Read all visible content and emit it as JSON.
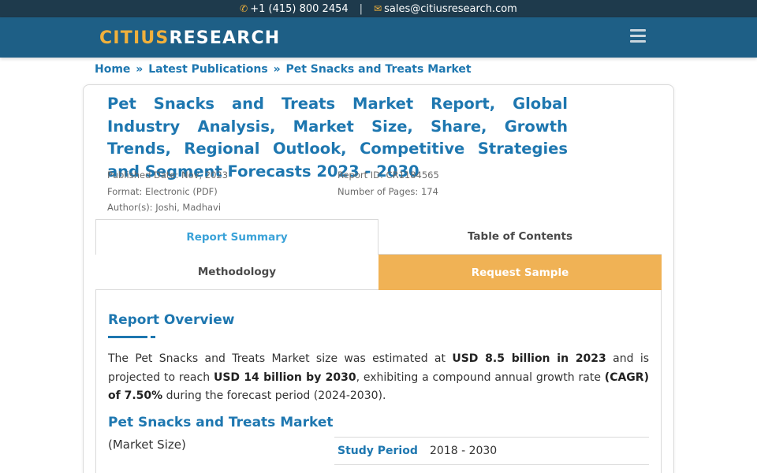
{
  "topbar": {
    "phone": "+1 (415) 800 2454",
    "separator": "|",
    "email": "sales@citiusresearch.com"
  },
  "brand": {
    "logo_part1": "CITIUS",
    "logo_part2": "RESEARCH"
  },
  "breadcrumb": {
    "home": "Home",
    "sep": "»",
    "latest": "Latest Publications",
    "current": "Pet Snacks and Treats Market"
  },
  "report": {
    "title": "Pet Snacks and Treats Market Report, Global Industry Analysis, Market Size, Share, Growth Trends, Regional Outlook, Competitive Strategies and Segment Forecasts 2023 - 2030",
    "published": "Published Date: Nov, 2023",
    "format": "Format: Electronic (PDF)",
    "authors": "Author(s): Joshi, Madhavi",
    "report_id": "Report ID: CR1184565",
    "pages": "Number of Pages: 174"
  },
  "tabs": {
    "summary": "Report Summary",
    "toc": "Table of Contents",
    "methodology": "Methodology",
    "sample": "Request Sample"
  },
  "overview": {
    "heading": "Report Overview",
    "p1": "The Pet Snacks and Treats Market size was estimated at ",
    "p1_bold": "USD 8.5 billion in 2023",
    "p2": " and is projected to reach ",
    "p2_bold": "USD 14 billion by 2030",
    "p3": ", exhibiting a compound annual growth rate ",
    "p3_bold": "(CAGR) of 7.50%",
    "p4": " during the forecast period (2024-2030)."
  },
  "market": {
    "heading": "Pet Snacks and Treats Market",
    "subheading": "(Market Size)"
  },
  "study_table": {
    "rows": [
      {
        "key": "Study Period",
        "value": "2018 - 2030"
      }
    ]
  },
  "colors": {
    "navbar": "#1e5f86",
    "topbar": "#1e3a4c",
    "accent_blue": "#1e77b0",
    "accent_orange": "#f0b255"
  }
}
